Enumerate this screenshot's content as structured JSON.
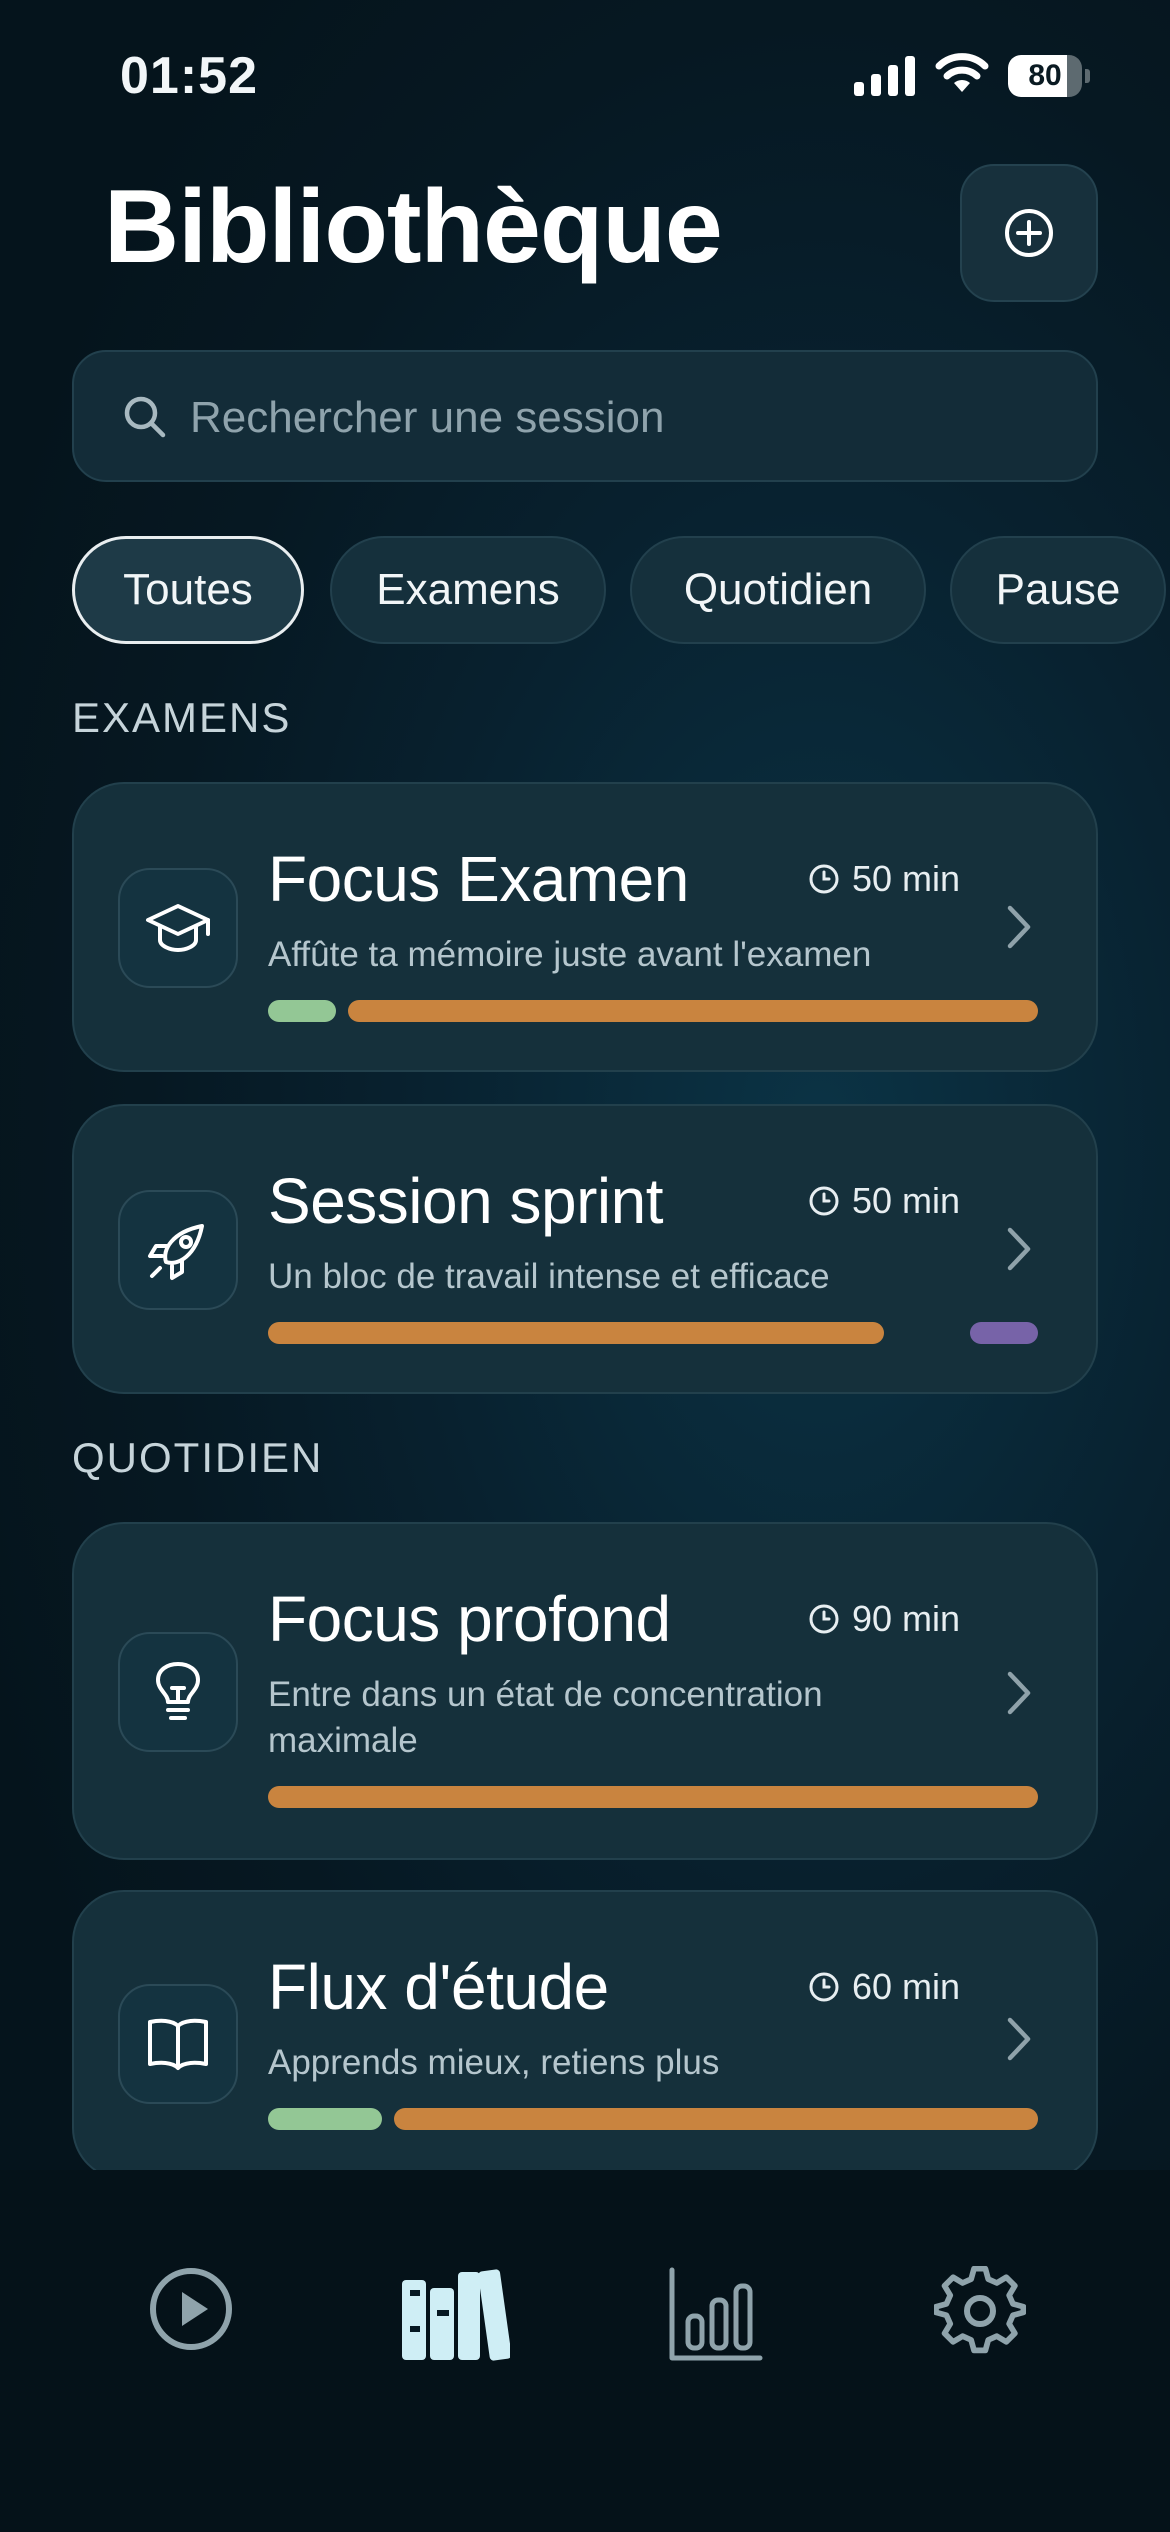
{
  "status_bar": {
    "time": "01:52",
    "battery_level": "80",
    "battery_percent": 80
  },
  "header": {
    "title": "Bibliothèque",
    "add_icon": "plus-circle-icon"
  },
  "search": {
    "placeholder": "Rechercher une session",
    "value": ""
  },
  "filters": [
    {
      "label": "Toutes",
      "active": true
    },
    {
      "label": "Examens",
      "active": false
    },
    {
      "label": "Quotidien",
      "active": false
    },
    {
      "label": "Pause",
      "active": false
    }
  ],
  "sections": [
    {
      "title": "EXAMENS",
      "cards": [
        {
          "title": "Focus Examen",
          "duration": "50 min",
          "description": "Affûte ta mémoire juste avant l'examen",
          "icon": "graduation-cap-icon"
        },
        {
          "title": "Session sprint",
          "duration": "50 min",
          "description": "Un bloc de travail intense et efficace",
          "icon": "rocket-icon"
        }
      ]
    },
    {
      "title": "QUOTIDIEN",
      "cards": [
        {
          "title": "Focus profond",
          "duration": "90 min",
          "description": "Entre dans un état de concentration maximale",
          "icon": "lightbulb-icon"
        },
        {
          "title": "Flux d'étude",
          "duration": "60 min",
          "description": "Apprends mieux, retiens plus",
          "icon": "open-book-icon"
        }
      ]
    }
  ],
  "colors": {
    "focus_segment": "#c9843f",
    "warmup_segment": "#93c795",
    "cooldown_segment": "#7763a8"
  },
  "tabbar": {
    "tabs": [
      {
        "icon": "play-circle-icon",
        "active": false
      },
      {
        "icon": "library-icon",
        "active": true
      },
      {
        "icon": "bar-chart-icon",
        "active": false
      },
      {
        "icon": "gear-icon",
        "active": false
      }
    ]
  }
}
